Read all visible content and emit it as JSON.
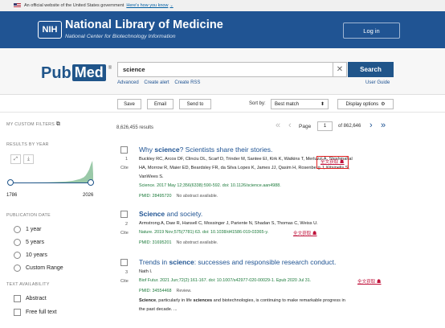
{
  "gov_banner": {
    "text": "An official website of the United States government",
    "link": "Here's how you know"
  },
  "header": {
    "nih": "NIH",
    "title": "National Library of Medicine",
    "subtitle": "National Center for Biotechnology Information",
    "login": "Log in"
  },
  "search": {
    "logo_pub": "Pub",
    "logo_med": "Med",
    "logo_reg": "®",
    "query": "science",
    "button": "Search",
    "links": [
      "Advanced",
      "Create alert",
      "Create RSS"
    ],
    "user_guide": "User Guide"
  },
  "toolbar": {
    "save": "Save",
    "email": "Email",
    "send_to": "Send to",
    "sort_by_label": "Sort by:",
    "sort_value": "Best match",
    "display_options": "Display options"
  },
  "sidebar": {
    "custom_filters": "MY CUSTOM FILTERS",
    "results_by_year": "RESULTS BY YEAR",
    "year_start": "1786",
    "year_end": "2026",
    "publication_date": "PUBLICATION DATE",
    "date_options": [
      "1 year",
      "5 years",
      "10 years",
      "Custom Range"
    ],
    "text_availability": "TEXT AVAILABILITY",
    "text_options": [
      "Abstract",
      "Free full text"
    ]
  },
  "results": {
    "count": "8,626,455 results",
    "page_label": "Page",
    "page": "1",
    "of_pages": "of 862,646"
  },
  "articles": [
    {
      "num": "1",
      "cite": "Cite",
      "title_pre": "Why ",
      "title_bold": "science",
      "title_post": "? Scientists share their stories.",
      "authors1": "Buckley RC, Arcos DF, Clinciu DL, Scarf D, Trinder M, Santee EI, Kirk K, Watkins T, Merluzzi A, Shishmahal",
      "authors2": "HA, Morrow R, Maier ED, Beardsley FR, da Silva Lopes K, James JJ, Qasim H, Rosenberg J, Kitsinelis S,",
      "authors3": "VanWees S.",
      "journal": "Science. 2017 May 12;356(6338):590-592. doi: 10.1126/science.aan4988.",
      "fulltext": "全文获取 ☗",
      "pmid": "PMID: 28495720",
      "note": "No abstract available."
    },
    {
      "num": "2",
      "cite": "Cite",
      "title_bold": "Science",
      "title_post": " and society.",
      "authors1": "Armstrong A, Daw R, Hansell C, Mossinger J, Pariente N, Shadan S, Thomas C, Weiss U.",
      "journal": "Nature. 2019 Nov;575(7781):63. doi: 10.1038/d41586-019-03365-y.",
      "fulltext": "全文获取 ☗",
      "pmid": "PMID: 31695201",
      "note": "No abstract available."
    },
    {
      "num": "3",
      "cite": "Cite",
      "title_pre": "Trends in ",
      "title_bold": "science",
      "title_post": ": successes and responsible research conduct.",
      "authors1": "Nath I.",
      "journal": "Biof Futur. 2021 Jun;72(2):161-167. doi: 10.1007/s42977-020-00029-1. Epub 2020 Jul 31.",
      "fulltext": "全文获取 ☗",
      "pmid": "PMID: 34554468",
      "note": "Review.",
      "snippet_b": "Science",
      "snippet_1": ", particularly in life ",
      "snippet_b2": "sciences",
      "snippet_2": " and biotechnologies, is continuing to make remarkable progress in",
      "snippet_3": "the past decade. ..."
    }
  ],
  "chart_data": {
    "type": "area",
    "x": [
      1786,
      1850,
      1900,
      1950,
      1970,
      1990,
      2000,
      2005,
      2010,
      2015,
      2020,
      2024,
      2026
    ],
    "values": [
      0,
      0,
      0.01,
      0.04,
      0.08,
      0.16,
      0.24,
      0.32,
      0.45,
      0.6,
      0.85,
      1.0,
      0.4
    ],
    "color": "#9ac9a8"
  }
}
